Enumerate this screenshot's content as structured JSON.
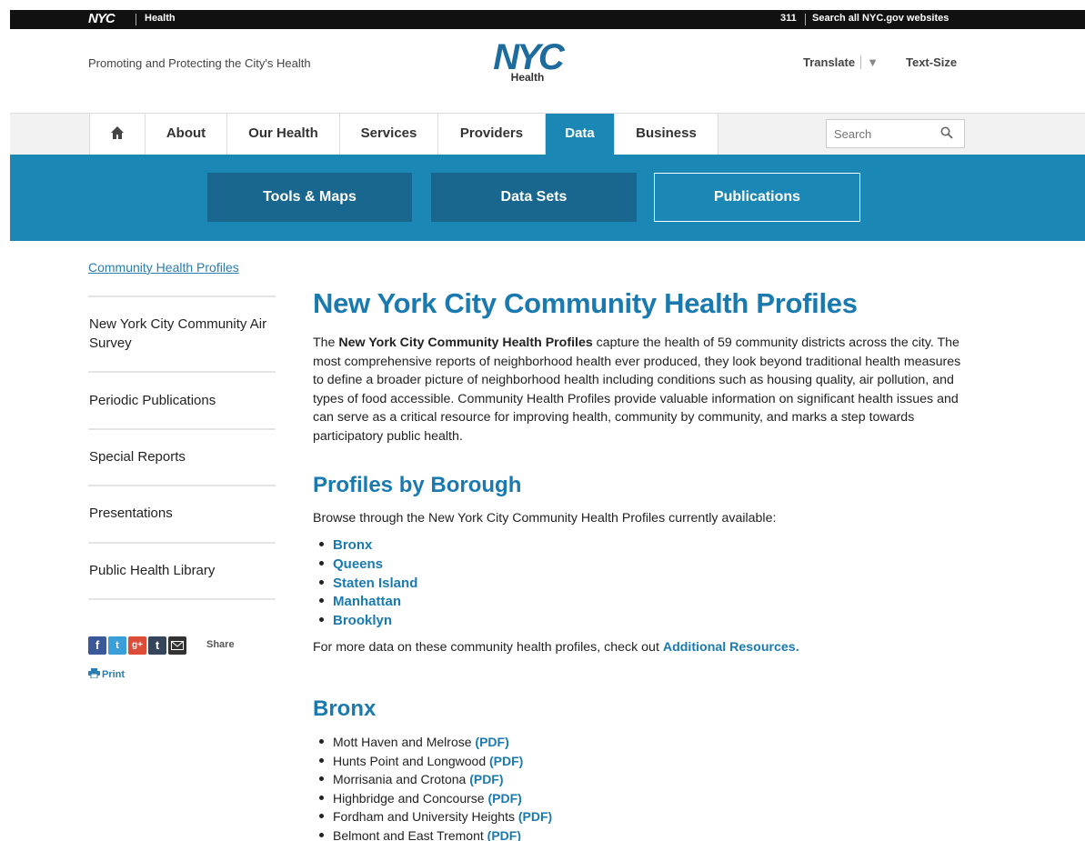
{
  "topbar": {
    "logo": "NYC",
    "agency": "Health",
    "phone": "311",
    "search_all": "Search all NYC.gov websites"
  },
  "header": {
    "tagline": "Promoting and Protecting the City's Health",
    "logo_big": "NYC",
    "logo_small": "Health",
    "translate": "Translate",
    "translate_arrow": "▼",
    "text_size": "Text-Size"
  },
  "nav": {
    "items": [
      {
        "label": "About"
      },
      {
        "label": "Our Health"
      },
      {
        "label": "Services"
      },
      {
        "label": "Providers"
      },
      {
        "label": "Data"
      },
      {
        "label": "Business"
      }
    ],
    "active": "Data",
    "search_placeholder": "Search"
  },
  "subnav": {
    "tools": "Tools & Maps",
    "datasets": "Data Sets",
    "publications": "Publications"
  },
  "sidebar": {
    "current": "Community Health Profiles",
    "items": [
      {
        "label": "New York City Community Air Survey"
      },
      {
        "label": "Periodic Publications"
      },
      {
        "label": "Special Reports"
      },
      {
        "label": "Presentations"
      },
      {
        "label": "Public Health Library"
      }
    ],
    "share": "Share",
    "print": "Print"
  },
  "main": {
    "title": "New York City Community Health Profiles",
    "intro_before": "The ",
    "intro_bold": "New York City Community Health Profiles",
    "intro_after": " capture the health of 59 community districts across the city. The most comprehensive reports of neighborhood health ever produced, they look beyond traditional health measures to define a broader picture of neighborhood health including conditions such as housing quality, air pollution, and types of food accessible. Community Health Profiles provide valuable information on significant health issues and can serve as a critical resource for improving health, community by community, and marks a step towards participatory public health.",
    "boroughs_heading": "Profiles by Borough",
    "browse_text": "Browse through the New York City Community Health Profiles currently available:",
    "boroughs": [
      "Bronx",
      "Queens",
      "Staten Island",
      "Manhattan",
      "Brooklyn"
    ],
    "more_before": "For more data on these community health profiles, check out ",
    "more_link": "Additional Resources.",
    "bronx_heading": "Bronx",
    "pdf_label": "(PDF)",
    "bronx_districts": [
      "Mott Haven and Melrose",
      "Hunts Point and Longwood",
      "Morrisania and Crotona",
      "Highbridge and Concourse",
      "Fordham and University Heights",
      "Belmont and East Tremont"
    ]
  },
  "colors": {
    "brand_blue": "#1a87b5",
    "link_blue": "#1a7ab0",
    "dark_button": "#19678f"
  }
}
